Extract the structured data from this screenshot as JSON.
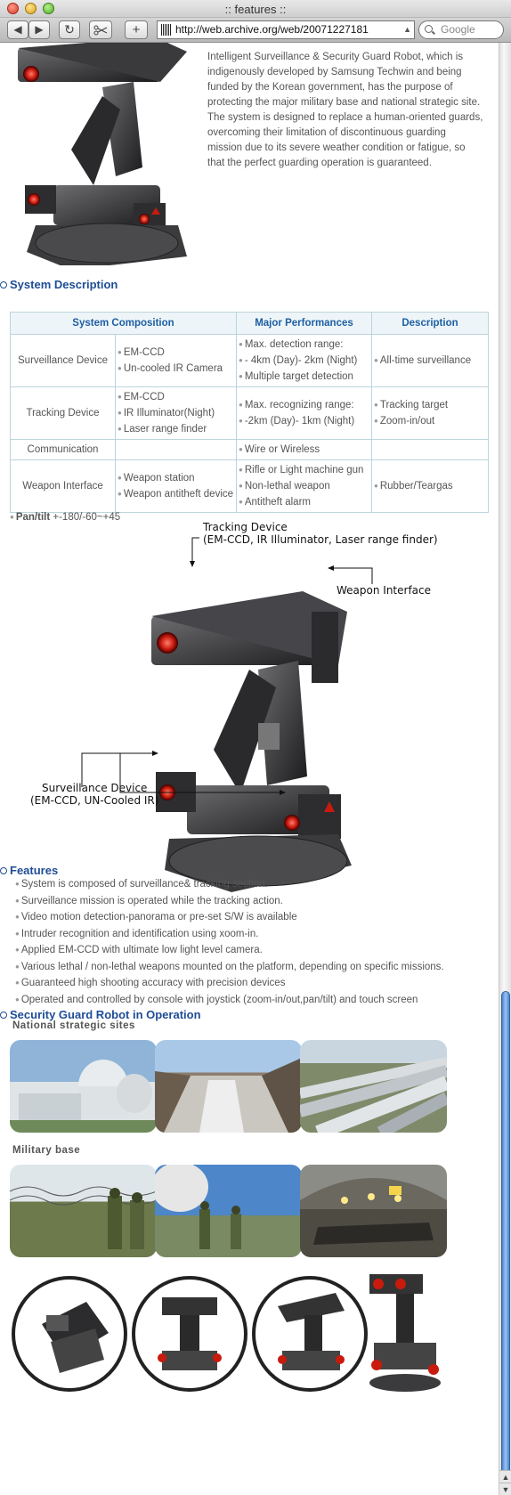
{
  "window": {
    "title": ":: features ::"
  },
  "toolbar": {
    "back": "◀",
    "forward": "▶",
    "reload": "↻",
    "add": "+",
    "url": "http://web.archive.org/web/20071227181",
    "search_placeholder": "Google"
  },
  "intro": {
    "p1": "Intelligent Surveillance & Security Guard Robot, which is indigenously developed by Samsung Techwin and being funded by the Korean government, has the purpose of protecting the major military base and national strategic site.",
    "p2": "The system is designed to replace a human-oriented guards, overcoming their limitation of discontinuous guarding mission due to its severe weather condition or fatigue, so that the perfect guarding operation is guaranteed."
  },
  "system_description": {
    "title": "System Description",
    "headers": [
      "System Composition",
      "Major Performances",
      "Description"
    ],
    "rows": [
      {
        "name": "Surveillance Device",
        "composition": [
          "EM-CCD",
          "Un-cooled IR Camera"
        ],
        "performance": [
          "Max. detection range:",
          "- 4km (Day)- 2km (Night)",
          "Multiple target detection"
        ],
        "description": [
          "All-time surveillance"
        ]
      },
      {
        "name": "Tracking Device",
        "composition": [
          "EM-CCD",
          "IR Illuminator(Night)",
          "Laser range finder"
        ],
        "performance": [
          "Max. recognizing range:",
          "-2km (Day)- 1km (Night)"
        ],
        "description": [
          "Tracking target",
          "Zoom-in/out"
        ]
      },
      {
        "name": "Communication",
        "composition": [],
        "performance": [
          "Wire or Wireless"
        ],
        "description": []
      },
      {
        "name": "Weapon Interface",
        "composition": [
          "Weapon station",
          "Weapon antitheft device"
        ],
        "performance": [
          "Rifle or Light machine gun",
          "Non-lethal weapon",
          "Antitheft alarm"
        ],
        "description": [
          "Rubber/Teargas"
        ]
      }
    ],
    "pan_label": "Pan/tilt",
    "pan_value": " +-180/-60~+45"
  },
  "diagram": {
    "tracking_line1": "Tracking Device",
    "tracking_line2": "(EM-CCD, IR Illuminator, Laser range finder)",
    "weapon": "Weapon Interface",
    "surv_line1": "Surveillance Device",
    "surv_line2": "(EM-CCD, UN-Cooled IR)"
  },
  "features": {
    "title": "Features",
    "items": [
      "System is composed of surveillance& tracking section.",
      "Surveillance mission is operated while the tracking action.",
      "Video motion detection-panorama or pre-set S/W is available",
      "Intruder recognition and identification using xoom-in.",
      "Applied EM-CCD with ultimate low light level camera.",
      "Various lethal / non-lethal weapons mounted on the platform, depending on specific missions.",
      "Guaranteed high shooting accuracy with precision devices",
      "Operated and controlled by console with joystick (zoom-in/out,pan/tilt) and touch screen"
    ]
  },
  "operation": {
    "title": "Security Guard Robot in Operation",
    "national": "National strategic sites",
    "military": "Military base"
  },
  "colors": {
    "heading": "#1e4d96",
    "table_header_bg": "#eef5f8",
    "table_border": "#bcd4dc",
    "scroll_thumb": "#4b83cf"
  }
}
